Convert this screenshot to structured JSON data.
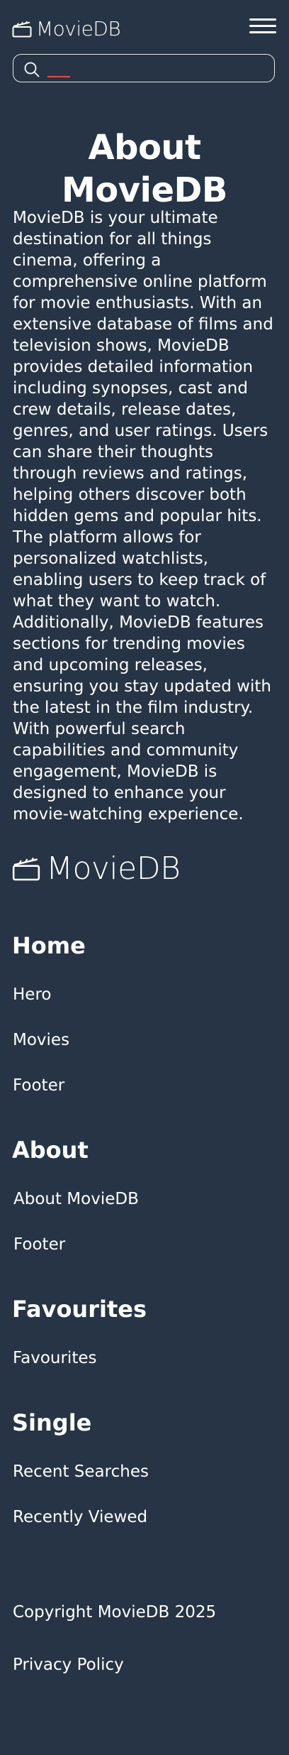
{
  "header": {
    "brand": "MovieDB",
    "menu_icon": "hamburger-icon",
    "search": {
      "placeholder": "",
      "value": "",
      "icon": "search-icon"
    }
  },
  "about": {
    "title": "About MovieDB",
    "body": "MovieDB is your ultimate destination for all things cinema, offering a comprehensive online platform for movie enthusiasts. With an extensive database of films and television shows, MovieDB provides detailed information including synopses, cast and crew details, release dates, genres, and user ratings. Users can share their thoughts through reviews and ratings, helping others discover both hidden gems and popular hits. The platform allows for personalized watchlists, enabling users to keep track of what they want to watch. Additionally, MovieDB features sections for trending movies and upcoming releases, ensuring you stay updated with the latest in the film industry. With powerful search capabilities and community engagement, MovieDB is designed to enhance your movie-watching experience."
  },
  "footer": {
    "brand": "MovieDB",
    "sections": [
      {
        "heading": "Home",
        "links": [
          "Hero",
          "Movies",
          "Footer"
        ]
      },
      {
        "heading": "About",
        "links": [
          "About MovieDB",
          "Footer"
        ]
      },
      {
        "heading": "Favourites",
        "links": [
          "Favourites"
        ]
      },
      {
        "heading": "Single",
        "links": [
          "Recent Searches",
          "Recently Viewed"
        ]
      }
    ],
    "copyright": "Copyright MovieDB 2025",
    "privacy": "Privacy Policy"
  },
  "colors": {
    "background": "#263445",
    "text": "#ffffff",
    "caret": "#e24b4b"
  }
}
